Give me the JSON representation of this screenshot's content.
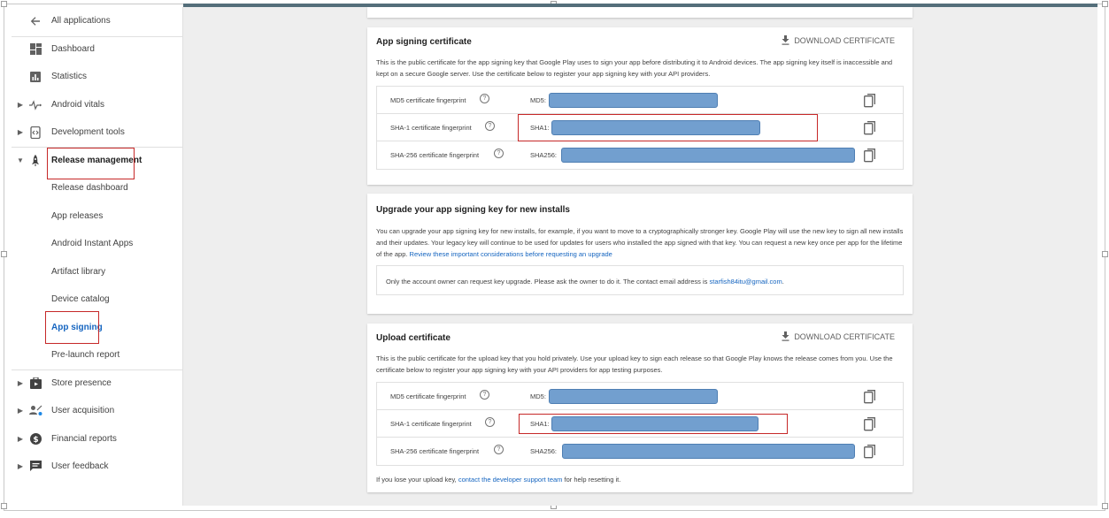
{
  "sidebar": {
    "back_label": "All applications",
    "items": [
      {
        "label": "Dashboard"
      },
      {
        "label": "Statistics"
      },
      {
        "label": "Android vitals"
      },
      {
        "label": "Development tools"
      },
      {
        "label": "Release management"
      },
      {
        "label": "Release dashboard"
      },
      {
        "label": "App releases"
      },
      {
        "label": "Android Instant Apps"
      },
      {
        "label": "Artifact library"
      },
      {
        "label": "Device catalog"
      },
      {
        "label": "App signing"
      },
      {
        "label": "Pre-launch report"
      },
      {
        "label": "Store presence"
      },
      {
        "label": "User acquisition"
      },
      {
        "label": "Financial reports"
      },
      {
        "label": "User feedback"
      }
    ]
  },
  "app_signing": {
    "title": "App signing certificate",
    "download_label": "DOWNLOAD CERTIFICATE",
    "description": "This is the public certificate for the app signing key that Google Play uses to sign your app before distributing it to Android devices. The app signing key itself is inaccessible and kept on a secure Google server. Use the certificate below to register your app signing key with your API providers.",
    "rows": [
      {
        "label": "MD5 certificate fingerprint",
        "prefix": "MD5:"
      },
      {
        "label": "SHA-1 certificate fingerprint",
        "prefix": "SHA1:"
      },
      {
        "label": "SHA-256 certificate fingerprint",
        "prefix": "SHA256:"
      }
    ]
  },
  "upgrade": {
    "title": "Upgrade your app signing key for new installs",
    "description": "You can upgrade your app signing key for new installs, for example, if you want to move to a cryptographically stronger key. Google Play will use the new key to sign all new installs and their updates. Your legacy key will continue to be used for updates for users who installed the app signed with that key. You can request a new key once per app for the lifetime of the app. ",
    "link": "Review these important considerations before requesting an upgrade",
    "notice": "Only the account owner can request key upgrade. Please ask the owner to do it. The contact email address is ",
    "email": "starfish84itu@gmail.com",
    "notice_end": "."
  },
  "upload": {
    "title": "Upload certificate",
    "download_label": "DOWNLOAD CERTIFICATE",
    "description": "This is the public certificate for the upload key that you hold privately. Use your upload key to sign each release so that Google Play knows the release comes from you. Use the certificate below to register your app signing key with your API providers for app testing purposes.",
    "rows": [
      {
        "label": "MD5 certificate fingerprint",
        "prefix": "MD5:"
      },
      {
        "label": "SHA-1 certificate fingerprint",
        "prefix": "SHA1:"
      },
      {
        "label": "SHA-256 certificate fingerprint",
        "prefix": "SHA256:"
      }
    ],
    "footer_before": "If you lose your upload key, ",
    "footer_link": "contact the developer support team",
    "footer_after": " for help resetting it."
  },
  "colors": {
    "accent": "#1565c0",
    "highlight_box": "#c62828",
    "redacted_bar": "#729fcf",
    "top_bar": "#546e7a"
  }
}
